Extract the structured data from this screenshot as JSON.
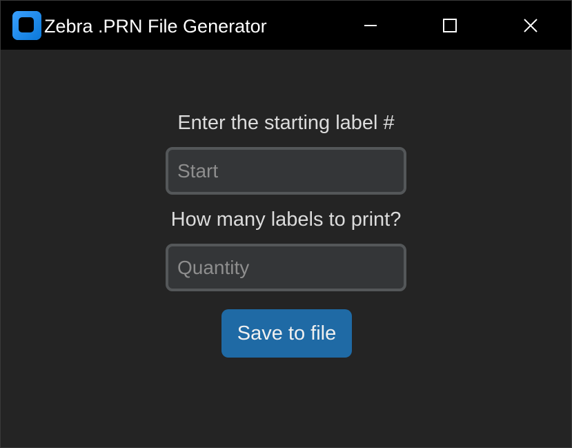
{
  "window": {
    "title": "Zebra .PRN File Generator",
    "icon": "app-icon",
    "controls": {
      "minimize_icon": "minimize-icon",
      "maximize_icon": "maximize-icon",
      "close_icon": "close-icon"
    }
  },
  "form": {
    "start_label": "Enter the starting label #",
    "start_placeholder": "Start",
    "start_value": "",
    "quantity_label": "How many labels to print?",
    "quantity_placeholder": "Quantity",
    "quantity_value": "",
    "save_button": "Save to file"
  },
  "colors": {
    "accent": "#1f6aa5",
    "background": "#242424",
    "titlebar": "#000000",
    "entry_background": "#343638",
    "entry_border": "#545759",
    "text": "#dcdcdc",
    "placeholder": "#8e8e8e"
  }
}
